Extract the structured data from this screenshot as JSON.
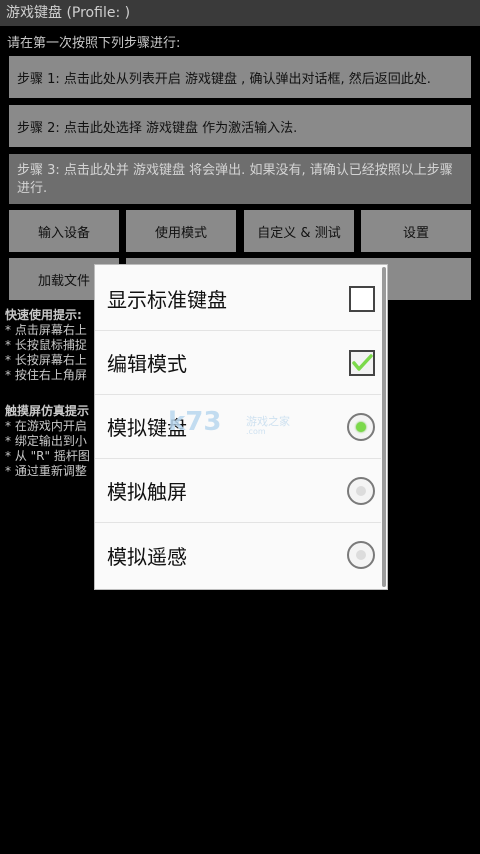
{
  "titlebar": {
    "title": "游戏键盘 (Profile: )"
  },
  "intro": "请在第一次按照下列步骤进行:",
  "steps": [
    {
      "label": "步骤 1: 点击此处从列表开启 游戏键盘 , 确认弹出对话框, 然后返回此处."
    },
    {
      "label": "步骤 2: 点击此处选择 游戏键盘 作为激活输入法."
    },
    {
      "label": "步骤 3: 点击此处并 游戏键盘 将会弹出. 如果没有, 请确认已经按照以上步骤进行."
    }
  ],
  "buttons": {
    "input_device": "输入设备",
    "use_mode": "使用模式",
    "customize_test": "自定义 & 测试",
    "settings": "设置",
    "load_file": "加载文件"
  },
  "tips_quick": {
    "head": "快速使用提示:",
    "lines": [
      "* 点击屏幕右上",
      "* 长按鼠标捕捉",
      "* 长按屏幕右上",
      "* 按住右上角屏"
    ]
  },
  "tips_touch": {
    "head": "触摸屏仿真提示",
    "lines": [
      "* 在游戏内开启",
      "* 绑定输出到小",
      "* 从 \"R\" 摇杆图",
      "* 通过重新调整"
    ]
  },
  "dialog": {
    "options": [
      {
        "label": "显示标准键盘",
        "control": "checkbox",
        "checked": false
      },
      {
        "label": "编辑模式",
        "control": "checkbox",
        "checked": true
      },
      {
        "label": "模拟键盘",
        "control": "radio",
        "checked": true
      },
      {
        "label": "模拟触屏",
        "control": "radio",
        "checked": false
      },
      {
        "label": "模拟遥感",
        "control": "radio",
        "checked": false
      }
    ]
  },
  "watermark": {
    "logo": "k73",
    "sub": "游戏之家",
    "url": ".com"
  },
  "colors": {
    "button_bg": "#8a8a8a",
    "check_accent": "#7bd94a",
    "radio_selected": "#7bd94a"
  }
}
